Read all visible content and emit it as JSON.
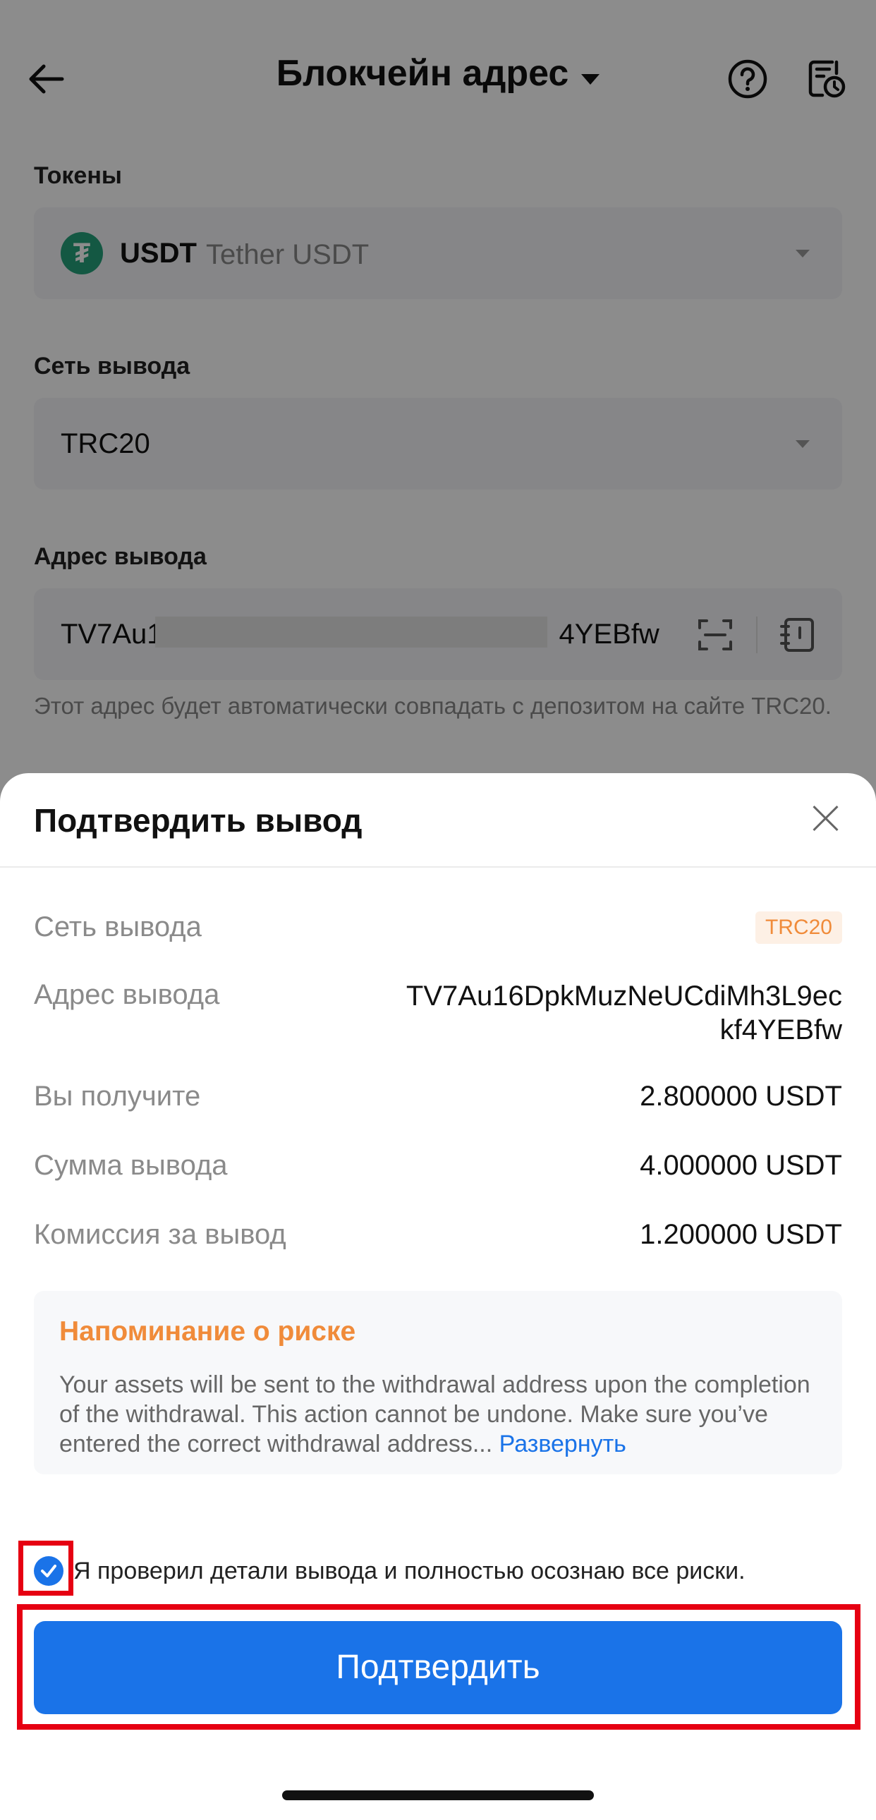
{
  "header": {
    "title": "Блокчейн адрес"
  },
  "form": {
    "tokens_label": "Токены",
    "token_symbol": "USDT",
    "token_name": "Tether USDT",
    "token_icon": "tether-icon",
    "network_label": "Сеть вывода",
    "network_value": "TRC20",
    "address_label": "Адрес вывода",
    "address_value": "TV7Au1",
    "address_value_end": "4YEBfw",
    "address_hint": "Этот адрес будет автоматически совпадать с депозитом на сайте TRC20."
  },
  "modal": {
    "title": "Подтвердить вывод",
    "rows": [
      {
        "label": "Сеть вывода",
        "value": "TRC20"
      },
      {
        "label": "Адрес вывода",
        "value": "TV7Au16DpkMuzNeUCdiMh3L9eckf4YEBfw"
      },
      {
        "label": "Вы получите",
        "value": "2.800000 USDT"
      },
      {
        "label": "Сумма вывода",
        "value": "4.000000 USDT"
      },
      {
        "label": "Комиссия за вывод",
        "value": "1.200000 USDT"
      }
    ],
    "risk_title": "Напоминание о риске",
    "risk_text": "Your assets will be sent to the withdrawal address upon the completion of the withdrawal. This action cannot be undone. Make sure you’ve entered the correct withdrawal address...",
    "risk_more": " Развернуть",
    "checkbox_label": "Я проверил детали вывода и полностью осознаю все риски.",
    "checkbox_checked": true,
    "confirm_label": "Подтвердить"
  },
  "colors": {
    "accent": "#1a73e8",
    "warning": "#f08b3a",
    "highlight": "#e60012",
    "tether": "#26a17b"
  }
}
